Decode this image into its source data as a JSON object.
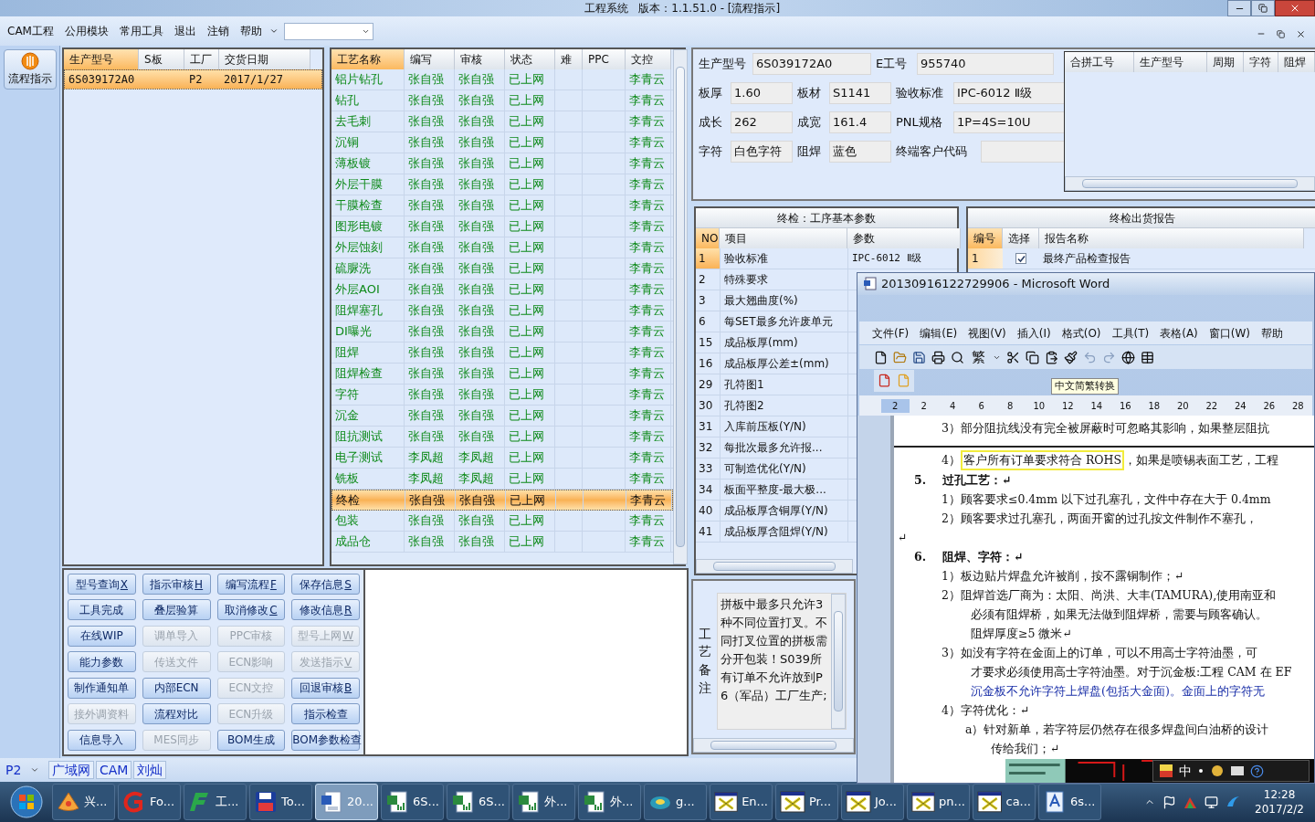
{
  "window": {
    "title": "工程系统   版本：1.1.51.0 - [流程指示]"
  },
  "menu": [
    "CAM工程",
    "公用模块",
    "常用工具",
    "退出",
    "注销",
    "帮助"
  ],
  "nav": {
    "label": "流程指示"
  },
  "products": {
    "columns": [
      "生产型号",
      "S板",
      "工厂",
      "交货日期"
    ],
    "rows": [
      {
        "cells": [
          "6S039172A0",
          "",
          "P2",
          "2017/1/27"
        ],
        "selected": true
      }
    ]
  },
  "process": {
    "columns": [
      "工艺名称",
      "编写",
      "审核",
      "状态",
      "难",
      "PPC",
      "文控"
    ],
    "rows": [
      {
        "cells": [
          "铝片钻孔",
          "张自强",
          "张自强",
          "已上网",
          "",
          "",
          "李青云"
        ],
        "selected": false
      },
      {
        "cells": [
          "钻孔",
          "张自强",
          "张自强",
          "已上网",
          "",
          "",
          "李青云"
        ],
        "selected": false
      },
      {
        "cells": [
          "去毛刺",
          "张自强",
          "张自强",
          "已上网",
          "",
          "",
          "李青云"
        ],
        "selected": false
      },
      {
        "cells": [
          "沉铜",
          "张自强",
          "张自强",
          "已上网",
          "",
          "",
          "李青云"
        ],
        "selected": false
      },
      {
        "cells": [
          "薄板镀",
          "张自强",
          "张自强",
          "已上网",
          "",
          "",
          "李青云"
        ],
        "selected": false
      },
      {
        "cells": [
          "外层干膜",
          "张自强",
          "张自强",
          "已上网",
          "",
          "",
          "李青云"
        ],
        "selected": false
      },
      {
        "cells": [
          "干膜检查",
          "张自强",
          "张自强",
          "已上网",
          "",
          "",
          "李青云"
        ],
        "selected": false
      },
      {
        "cells": [
          "图形电镀",
          "张自强",
          "张自强",
          "已上网",
          "",
          "",
          "李青云"
        ],
        "selected": false
      },
      {
        "cells": [
          "外层蚀刻",
          "张自强",
          "张自强",
          "已上网",
          "",
          "",
          "李青云"
        ],
        "selected": false
      },
      {
        "cells": [
          "硫脲洗",
          "张自强",
          "张自强",
          "已上网",
          "",
          "",
          "李青云"
        ],
        "selected": false
      },
      {
        "cells": [
          "外层AOI",
          "张自强",
          "张自强",
          "已上网",
          "",
          "",
          "李青云"
        ],
        "selected": false
      },
      {
        "cells": [
          "阻焊塞孔",
          "张自强",
          "张自强",
          "已上网",
          "",
          "",
          "李青云"
        ],
        "selected": false
      },
      {
        "cells": [
          "DI曝光",
          "张自强",
          "张自强",
          "已上网",
          "",
          "",
          "李青云"
        ],
        "selected": false
      },
      {
        "cells": [
          "阻焊",
          "张自强",
          "张自强",
          "已上网",
          "",
          "",
          "李青云"
        ],
        "selected": false
      },
      {
        "cells": [
          "阻焊检查",
          "张自强",
          "张自强",
          "已上网",
          "",
          "",
          "李青云"
        ],
        "selected": false
      },
      {
        "cells": [
          "字符",
          "张自强",
          "张自强",
          "已上网",
          "",
          "",
          "李青云"
        ],
        "selected": false
      },
      {
        "cells": [
          "沉金",
          "张自强",
          "张自强",
          "已上网",
          "",
          "",
          "李青云"
        ],
        "selected": false
      },
      {
        "cells": [
          "阻抗测试",
          "张自强",
          "张自强",
          "已上网",
          "",
          "",
          "李青云"
        ],
        "selected": false
      },
      {
        "cells": [
          "电子测试",
          "李凤超",
          "李凤超",
          "已上网",
          "",
          "",
          "李青云"
        ],
        "selected": false
      },
      {
        "cells": [
          "铣板",
          "李凤超",
          "李凤超",
          "已上网",
          "",
          "",
          "李青云"
        ],
        "selected": false
      },
      {
        "cells": [
          "终检",
          "张自强",
          "张自强",
          "已上网",
          "",
          "",
          "李青云"
        ],
        "selected": true
      },
      {
        "cells": [
          "包装",
          "张自强",
          "张自强",
          "已上网",
          "",
          "",
          "李青云"
        ],
        "selected": false
      },
      {
        "cells": [
          "成品仓",
          "张自强",
          "张自强",
          "已上网",
          "",
          "",
          "李青云"
        ],
        "selected": false
      }
    ]
  },
  "buttons": [
    {
      "label": "型号查询",
      "key": "X",
      "disabled": false
    },
    {
      "label": "指示审核",
      "key": "H",
      "disabled": false
    },
    {
      "label": "编写流程",
      "key": "F",
      "disabled": false
    },
    {
      "label": "保存信息",
      "key": "S",
      "disabled": false
    },
    {
      "label": "工具完成",
      "disabled": false
    },
    {
      "label": "叠层验算",
      "disabled": false
    },
    {
      "label": "取消修改",
      "key": "C",
      "disabled": false
    },
    {
      "label": "修改信息",
      "key": "R",
      "disabled": false
    },
    {
      "label": "在线WIP",
      "disabled": false
    },
    {
      "label": "调单导入",
      "disabled": true
    },
    {
      "label": "PPC审核",
      "disabled": true
    },
    {
      "label": "型号上网",
      "key": "W",
      "disabled": true
    },
    {
      "label": "能力参数",
      "disabled": false
    },
    {
      "label": "传送文件",
      "disabled": true
    },
    {
      "label": "ECN影响",
      "disabled": true
    },
    {
      "label": "发送指示",
      "key": "V",
      "disabled": true
    },
    {
      "label": "制作通知单",
      "disabled": false
    },
    {
      "label": "内部ECN",
      "disabled": false
    },
    {
      "label": "ECN文控",
      "disabled": true
    },
    {
      "label": "回退审核",
      "key": "B",
      "disabled": false
    },
    {
      "label": "接外调资料",
      "disabled": true
    },
    {
      "label": "流程对比",
      "disabled": false
    },
    {
      "label": "ECN升级",
      "disabled": true
    },
    {
      "label": "指示检查",
      "disabled": false
    },
    {
      "label": "信息导入",
      "disabled": false
    },
    {
      "label": "MES同步",
      "disabled": true
    },
    {
      "label": "BOM生成",
      "disabled": false
    },
    {
      "label": "BOM参数检查",
      "disabled": false
    }
  ],
  "info": [
    [
      {
        "label": "生产型号",
        "value": "6S039172A0"
      },
      {
        "label": "E工号",
        "value": "955740"
      }
    ],
    [
      {
        "label": "板厚",
        "value": "1.60"
      },
      {
        "label": "板材",
        "value": "S1141"
      },
      {
        "label": "验收标准",
        "value": "IPC-6012 Ⅱ级"
      }
    ],
    [
      {
        "label": "成长",
        "value": "262"
      },
      {
        "label": "成宽",
        "value": "161.4"
      },
      {
        "label": "PNL规格",
        "value": "1P=4S=10U"
      }
    ],
    [
      {
        "label": "字符",
        "value": "白色字符"
      },
      {
        "label": "阻焊",
        "value": "蓝色"
      },
      {
        "label": "终端客户代码"
      }
    ]
  ],
  "merge_table": {
    "columns": [
      "合拼工号",
      "生产型号",
      "周期",
      "字符",
      "阻焊"
    ]
  },
  "params": {
    "title": "终检：工序基本参数",
    "columns": [
      "NO",
      "项目",
      "参数"
    ],
    "rows": [
      {
        "no": "1",
        "item": "验收标准",
        "param": "IPC-6012 Ⅱ级",
        "selected": true
      },
      {
        "no": "2",
        "item": "特殊要求",
        "selected": false
      },
      {
        "no": "3",
        "item": "最大翘曲度(%)",
        "selected": false
      },
      {
        "no": "6",
        "item": "每SET最多允许废单元",
        "selected": false
      },
      {
        "no": "15",
        "item": "成品板厚(mm)",
        "selected": false
      },
      {
        "no": "16",
        "item": "成品板厚公差±(mm)",
        "selected": false
      },
      {
        "no": "29",
        "item": "孔符图1",
        "selected": false
      },
      {
        "no": "30",
        "item": "孔符图2",
        "selected": false
      },
      {
        "no": "31",
        "item": "入库前压板(Y/N)",
        "selected": false
      },
      {
        "no": "32",
        "item": "每批次最多允许报...",
        "selected": false
      },
      {
        "no": "33",
        "item": "可制造优化(Y/N)",
        "selected": false
      },
      {
        "no": "34",
        "item": "板面平整度-最大极...",
        "selected": false
      },
      {
        "no": "40",
        "item": "成品板厚含铜厚(Y/N)",
        "selected": false
      },
      {
        "no": "41",
        "item": "成品板厚含阻焊(Y/N)",
        "selected": false
      }
    ]
  },
  "report": {
    "title": "终检出货报告",
    "columns": [
      "编号",
      "选择",
      "报告名称"
    ],
    "rows": [
      {
        "no": "1",
        "checked": true,
        "name": "最终产品检查报告"
      }
    ]
  },
  "remark": {
    "label": "工艺备注",
    "text": "拼板中最多只允许3种不同位置打叉。不同打叉位置的拼板需分开包装！S039所有订单不允许放到P6（军品）工厂生产;"
  },
  "status_bar": {
    "factory": "P2",
    "cells": [
      "广域网",
      "CAM",
      "刘灿"
    ]
  },
  "word": {
    "title": "20130916122729906 - Microsoft Word",
    "menu": [
      "文件(F)",
      "编辑(E)",
      "视图(V)",
      "插入(I)",
      "格式(O)",
      "工具(T)",
      "表格(A)",
      "窗口(W)",
      "帮助"
    ],
    "toolbar_text": "繁",
    "tooltip": "中文简繁转换",
    "ruler": [
      "2",
      "2",
      "4",
      "6",
      "8",
      "10",
      "12",
      "14",
      "16",
      "18",
      "20",
      "22",
      "24",
      "26",
      "28"
    ],
    "lines": [
      {
        "kind": "item",
        "text": "3）部分阻抗线没有完全被屏蔽时可忽略其影响，如果整层阻抗"
      },
      {
        "kind": "break"
      },
      {
        "kind": "marked",
        "text": "4）",
        "mark": "客户所有订单要求符合 ROHS",
        "rest": "，如果是喷锡表面工艺，工程"
      },
      {
        "kind": "heading",
        "num": "5.",
        "text": "过孔工艺：↵"
      },
      {
        "kind": "item",
        "text": "1）顾客要求≤0.4mm 以下过孔塞孔，文件中存在大于 0.4mm"
      },
      {
        "kind": "item",
        "text": "2）顾客要求过孔塞孔，两面开窗的过孔按文件制作不塞孔，"
      },
      {
        "kind": "blank",
        "text": "↵"
      },
      {
        "kind": "heading",
        "num": "6.",
        "text": "阻焊、字符：↵"
      },
      {
        "kind": "item",
        "text": "1）板边贴片焊盘允许被削，按不露铜制作；↵"
      },
      {
        "kind": "item",
        "text": "2）阻焊首选厂商为：太阳、尚洪、大丰(TAMURA),使用南亚和"
      },
      {
        "kind": "cont",
        "text": "必须有阻焊桥，如果无法做到阻焊桥，需要与顾客确认。"
      },
      {
        "kind": "cont",
        "text": "阻焊厚度≥5 微米↵"
      },
      {
        "kind": "item",
        "text": "3）如没有字符在金面上的订单，可以不用高士字符油墨，可"
      },
      {
        "kind": "cont",
        "text": "才要求必须使用高士字符油墨。对于沉金板:工程 CAM 在 EF"
      },
      {
        "kind": "note",
        "text": "沉金板不允许字符上焊盘(包括大金面)。金面上的字符无"
      },
      {
        "kind": "item",
        "text": "4）字符优化：↵"
      },
      {
        "kind": "sub",
        "text": "a）针对新单，若字符层仍然存在很多焊盘间白油桥的设计"
      },
      {
        "kind": "subcont",
        "text": "传给我们；↵"
      }
    ],
    "ime": "中"
  },
  "taskbar": [
    {
      "kind": "shell",
      "label": "兴...",
      "selected": false
    },
    {
      "kind": "glogo",
      "label": "Fo...",
      "selected": false
    },
    {
      "kind": "flogo",
      "label": "工...",
      "selected": false
    },
    {
      "kind": "floppy",
      "label": "To...",
      "selected": false
    },
    {
      "kind": "word",
      "label": "20...",
      "selected": true
    },
    {
      "kind": "excel",
      "label": "6S...",
      "selected": false
    },
    {
      "kind": "excel",
      "label": "6S...",
      "selected": false
    },
    {
      "kind": "excel",
      "label": "外...",
      "selected": false
    },
    {
      "kind": "excel",
      "label": "外...",
      "selected": false
    },
    {
      "kind": "disc",
      "label": "g...",
      "selected": false
    },
    {
      "kind": "xwin",
      "label": "En...",
      "selected": false
    },
    {
      "kind": "xwin",
      "label": "Pr...",
      "selected": false
    },
    {
      "kind": "xwin",
      "label": "Jo...",
      "selected": false
    },
    {
      "kind": "xwin",
      "label": "pn...",
      "selected": false
    },
    {
      "kind": "xwin",
      "label": "ca...",
      "selected": false
    },
    {
      "kind": "doc",
      "label": "6s...",
      "selected": false
    }
  ],
  "clock": {
    "time": "12:28",
    "date": "2017/2/2"
  }
}
